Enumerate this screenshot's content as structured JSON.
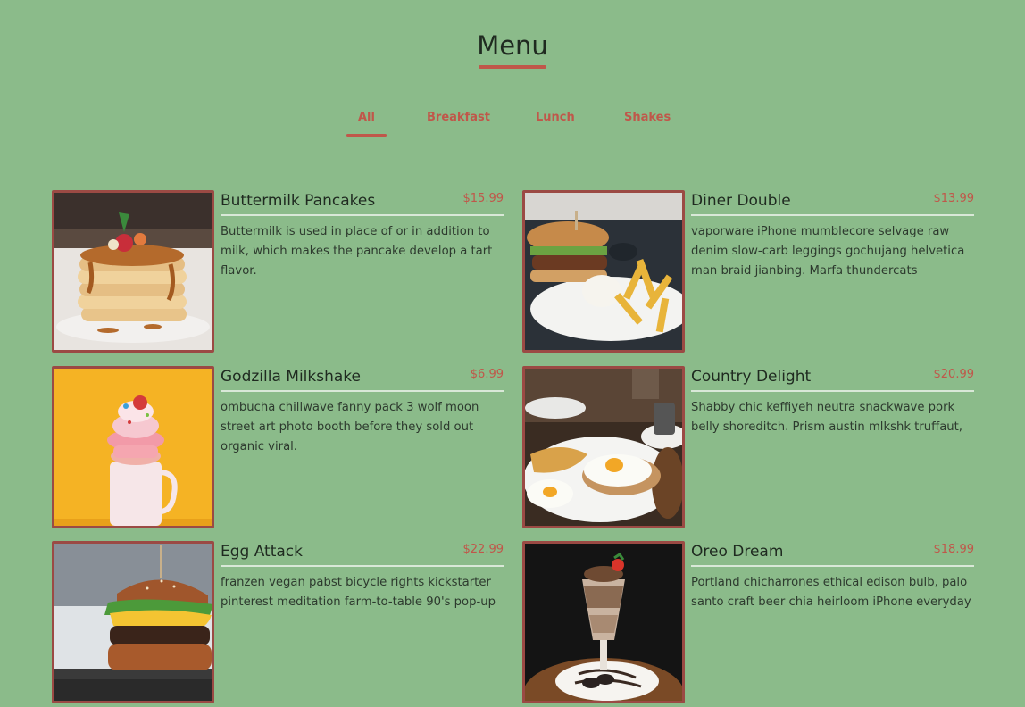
{
  "title": "Menu",
  "tabs": [
    "All",
    "Breakfast",
    "Lunch",
    "Shakes"
  ],
  "items": [
    {
      "name": "Buttermilk Pancakes",
      "price": "$15.99",
      "desc": "Buttermilk is used in place of or in addition to milk, which makes the pancake develop a tart flavor.",
      "image": "pancakes-photo"
    },
    {
      "name": "Diner Double",
      "price": "$13.99",
      "desc": "vaporware iPhone mumblecore selvage raw denim slow-carb leggings gochujang helvetica man braid jianbing. Marfa thundercats",
      "image": "burger-fries-photo"
    },
    {
      "name": "Godzilla Milkshake",
      "price": "$6.99",
      "desc": "ombucha chillwave fanny pack 3 wolf moon street art photo booth before they sold out organic viral.",
      "image": "milkshake-yellow-photo"
    },
    {
      "name": "Country Delight",
      "price": "$20.99",
      "desc": "Shabby chic keffiyeh neutra snackwave pork belly shoreditch. Prism austin mlkshk truffaut,",
      "image": "eggs-breakfast-photo"
    },
    {
      "name": "Egg Attack",
      "price": "$22.99",
      "desc": "franzen vegan pabst bicycle rights kickstarter pinterest meditation farm-to-table 90's pop-up",
      "image": "egg-burger-photo"
    },
    {
      "name": "Oreo Dream",
      "price": "$18.99",
      "desc": "Portland chicharrones ethical edison bulb, palo santo craft beer chia heirloom iPhone everyday",
      "image": "oreo-shake-photo"
    }
  ]
}
